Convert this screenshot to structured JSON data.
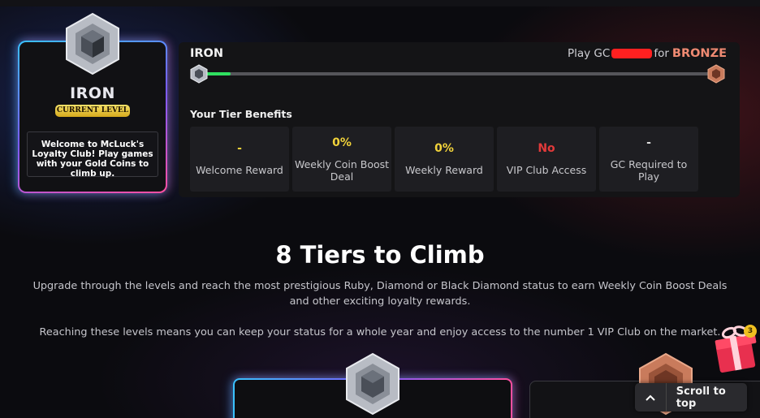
{
  "current_level": {
    "name": "IRON",
    "badge": "CURRENT LEVEL",
    "description": "Welcome to McLuck's Loyalty Club! Play games with your Gold Coins to climb up."
  },
  "progress": {
    "current_tier": "IRON",
    "play_prefix": "Play GC",
    "play_suffix": "for",
    "next_tier": "BRONZE",
    "fraction": 0.06
  },
  "benefits": {
    "title": "Your Tier Benefits",
    "items": [
      {
        "value": "-",
        "label": "Welcome Reward",
        "color": "#f2d33a"
      },
      {
        "value": "0%",
        "label": "Weekly Coin Boost Deal",
        "color": "#f2d33a"
      },
      {
        "value": "0%",
        "label": "Weekly Reward",
        "color": "#f2d33a"
      },
      {
        "value": "No",
        "label": "VIP Club Access",
        "color": "#e23a3a"
      },
      {
        "value": "-",
        "label": "GC Required to Play",
        "color": "#dddddd"
      }
    ]
  },
  "section": {
    "title": "8 Tiers to Climb",
    "description": "Upgrade through the levels and reach the most prestigious Ruby, Diamond or Black Diamond status to earn Weekly Coin Boost Deals and other exciting loyalty rewards.",
    "note": "Reaching these levels means you can keep your status for a whole year and enjoy access to the number 1 VIP Club on the market."
  },
  "gift": {
    "count": "3"
  },
  "scroll_top": {
    "label": "Scroll to top"
  },
  "colors": {
    "accent_green": "#2fe060",
    "bronze": "#ef8a72",
    "gold": "#f2d33a"
  }
}
